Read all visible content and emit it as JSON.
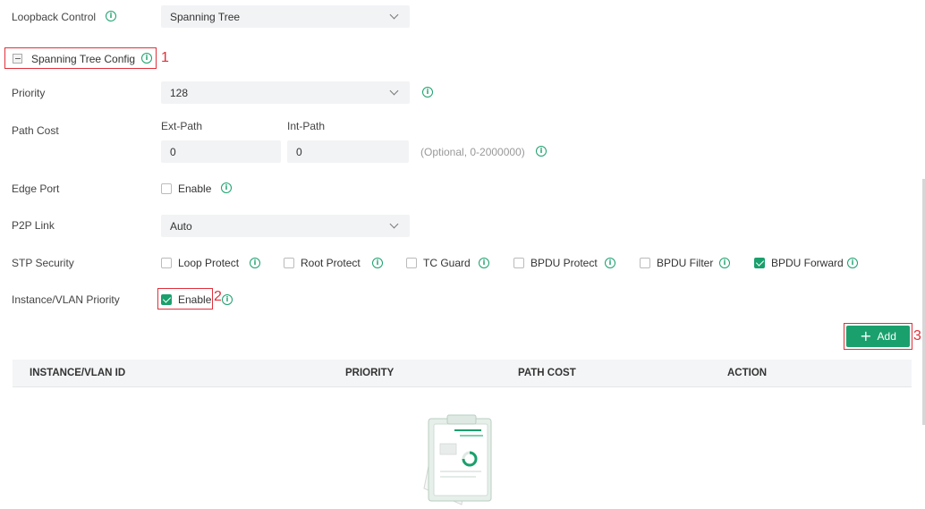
{
  "loopback": {
    "label": "Loopback Control",
    "value": "Spanning Tree"
  },
  "stp_config": {
    "label": "Spanning Tree Config",
    "marker": "1"
  },
  "priority": {
    "label": "Priority",
    "value": "128"
  },
  "path_cost": {
    "label": "Path Cost",
    "ext_label": "Ext-Path",
    "int_label": "Int-Path",
    "ext_value": "0",
    "int_value": "0",
    "hint": "(Optional, 0-2000000)"
  },
  "edge_port": {
    "label": "Edge Port",
    "option": "Enable",
    "checked": false
  },
  "p2p_link": {
    "label": "P2P Link",
    "value": "Auto"
  },
  "stp_security": {
    "label": "STP Security",
    "options": [
      {
        "label": "Loop Protect",
        "checked": false
      },
      {
        "label": "Root Protect",
        "checked": false
      },
      {
        "label": "TC Guard",
        "checked": false
      },
      {
        "label": "BPDU Protect",
        "checked": false
      },
      {
        "label": "BPDU Filter",
        "checked": false
      },
      {
        "label": "BPDU Forward",
        "checked": true
      }
    ]
  },
  "instance_vlan": {
    "label": "Instance/VLAN Priority",
    "option": "Enable",
    "checked": true,
    "marker": "2"
  },
  "add_button": {
    "label": "Add",
    "marker": "3"
  },
  "table": {
    "columns": [
      "INSTANCE/VLAN ID",
      "PRIORITY",
      "PATH COST",
      "ACTION"
    ]
  },
  "colors": {
    "accent": "#1aa06d",
    "highlight": "#e0303a"
  }
}
